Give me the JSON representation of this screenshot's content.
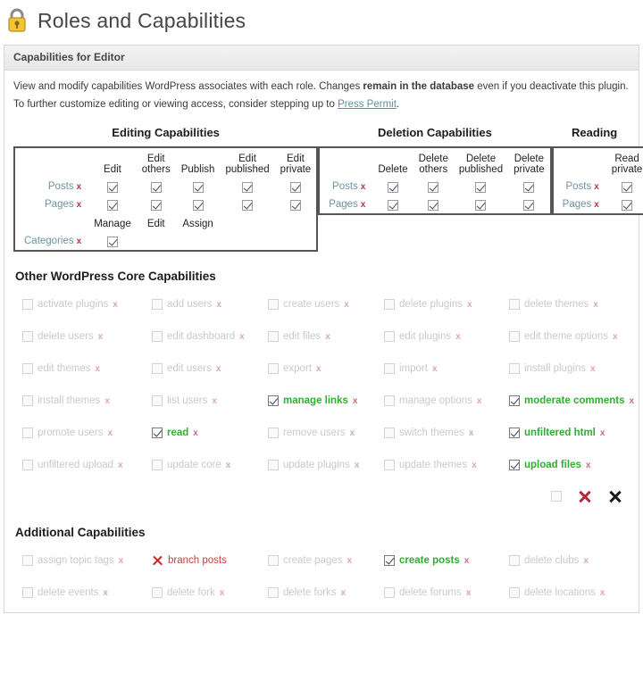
{
  "header": {
    "icon": "padlock-icon",
    "title": "Roles and Capabilities"
  },
  "panel": {
    "heading": "Capabilities for Editor",
    "intro_line1_a": "View and modify capabilities WordPress associates with each role. Changes ",
    "intro_line1_b": "remain in the database",
    "intro_line1_c": " even if you deactivate this plugin.",
    "intro_line2_a": "To further customize editing or viewing access, consider stepping up to ",
    "intro_line2_link": "Press Permit",
    "intro_line2_c": "."
  },
  "tables": [
    {
      "title": "Editing Capabilities",
      "name": "editing-capabilities-table",
      "columns": [
        "Edit",
        "Edit others",
        "Publish",
        "Edit published",
        "Edit private"
      ],
      "rows": [
        {
          "label": "Posts",
          "remove": "x",
          "checks": [
            true,
            true,
            true,
            true,
            true
          ]
        },
        {
          "label": "Pages",
          "remove": "x",
          "checks": [
            true,
            true,
            true,
            true,
            true
          ]
        }
      ],
      "sub_columns": [
        "Manage",
        "Edit",
        "Assign"
      ],
      "sub_rows": [
        {
          "label": "Categories",
          "remove": "x",
          "checks": [
            true,
            null,
            null
          ]
        }
      ]
    },
    {
      "title": "Deletion Capabilities",
      "name": "deletion-capabilities-table",
      "columns": [
        "Delete",
        "Delete others",
        "Delete published",
        "Delete private"
      ],
      "rows": [
        {
          "label": "Posts",
          "remove": "x",
          "checks": [
            true,
            true,
            true,
            true
          ]
        },
        {
          "label": "Pages",
          "remove": "x",
          "checks": [
            true,
            true,
            true,
            true
          ]
        }
      ]
    },
    {
      "title": "Reading",
      "name": "reading-capabilities-table",
      "columns": [
        "Read private"
      ],
      "rows": [
        {
          "label": "Posts",
          "remove": "x",
          "checks": [
            true
          ]
        },
        {
          "label": "Pages",
          "remove": "x",
          "checks": [
            true
          ]
        }
      ]
    }
  ],
  "core": {
    "title": "Other WordPress Core Capabilities",
    "remove_mark": "x",
    "items": [
      {
        "label": "activate plugins",
        "state": "off"
      },
      {
        "label": "add users",
        "state": "off"
      },
      {
        "label": "create users",
        "state": "off"
      },
      {
        "label": "delete plugins",
        "state": "off"
      },
      {
        "label": "delete themes",
        "state": "off"
      },
      {
        "label": "delete users",
        "state": "off"
      },
      {
        "label": "edit dashboard",
        "state": "off"
      },
      {
        "label": "edit files",
        "state": "off"
      },
      {
        "label": "edit plugins",
        "state": "off"
      },
      {
        "label": "edit theme options",
        "state": "off"
      },
      {
        "label": "edit themes",
        "state": "off"
      },
      {
        "label": "edit users",
        "state": "off"
      },
      {
        "label": "export",
        "state": "off"
      },
      {
        "label": "import",
        "state": "off"
      },
      {
        "label": "install plugins",
        "state": "off"
      },
      {
        "label": "install themes",
        "state": "off"
      },
      {
        "label": "list users",
        "state": "off"
      },
      {
        "label": "manage links",
        "state": "on"
      },
      {
        "label": "manage options",
        "state": "off"
      },
      {
        "label": "moderate comments",
        "state": "on"
      },
      {
        "label": "promote users",
        "state": "off"
      },
      {
        "label": "read",
        "state": "on"
      },
      {
        "label": "remove users",
        "state": "off"
      },
      {
        "label": "switch themes",
        "state": "off"
      },
      {
        "label": "unfiltered html",
        "state": "on"
      },
      {
        "label": "unfiltered upload",
        "state": "off"
      },
      {
        "label": "update core",
        "state": "off"
      },
      {
        "label": "update plugins",
        "state": "off"
      },
      {
        "label": "update themes",
        "state": "off"
      },
      {
        "label": "upload files",
        "state": "on"
      }
    ]
  },
  "additional": {
    "title": "Additional Capabilities",
    "remove_mark": "x",
    "items": [
      {
        "label": "assign topic tags",
        "state": "off"
      },
      {
        "label": "branch posts",
        "state": "denied"
      },
      {
        "label": "create pages",
        "state": "off"
      },
      {
        "label": "create posts",
        "state": "on"
      },
      {
        "label": "delete clubs",
        "state": "off"
      },
      {
        "label": "delete events",
        "state": "off"
      },
      {
        "label": "delete fork",
        "state": "off"
      },
      {
        "label": "delete forks",
        "state": "off"
      },
      {
        "label": "delete forums",
        "state": "off"
      },
      {
        "label": "delete locations",
        "state": "off"
      }
    ]
  },
  "colors": {
    "checked_green": "#2faf2f",
    "denied_red": "#d23a3a",
    "remove_x": "#c0334a",
    "link_blue": "#5b8fa8",
    "row_label": "#6f92a3"
  }
}
